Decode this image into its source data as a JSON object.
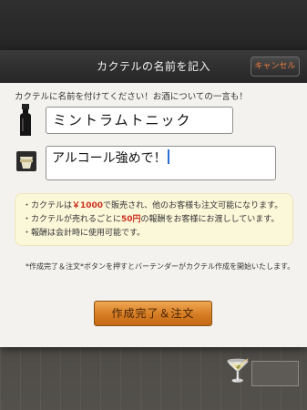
{
  "dialog": {
    "title": "カクテルの名前を記入",
    "cancel_label": "キャンセル"
  },
  "form": {
    "instruction": "カクテルに名前を付けてください！お酒についての一言も！",
    "name_value": "ミントラムトニック",
    "comment_value": "アルコール強めで！"
  },
  "info": {
    "line1_pre": "・カクテルは",
    "line1_price": "￥1000",
    "line1_post": "で販売され、他のお客様も注文可能になります。",
    "line2_pre": "・カクテルが売れるごとに",
    "line2_reward": "50円",
    "line2_post": "の報酬をお客様にお渡ししています。",
    "line3": "・報酬は会計時に使用可能です。"
  },
  "note": "*作成完了＆注文*ボタンを押すとバーテンダーがカクテル作成を開始いたします。",
  "order_button_label": "作成完了＆注文",
  "icons": {
    "bottle": "bottle-icon",
    "drink": "drink-icon",
    "glass": "martini-glass-icon"
  },
  "colors": {
    "accent": "#d57c23",
    "highlight": "#cc3322",
    "cancel": "#f07a3c"
  }
}
